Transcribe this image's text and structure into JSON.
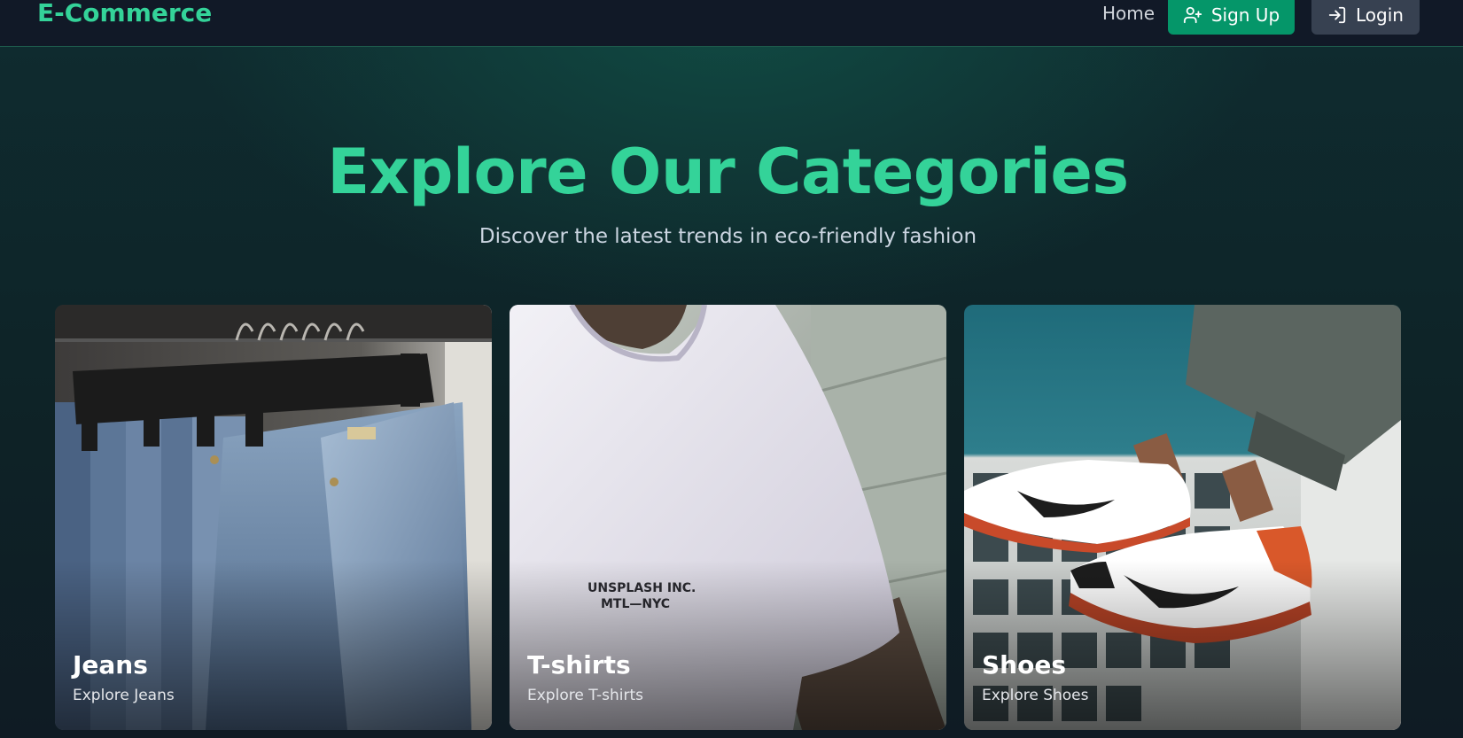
{
  "navbar": {
    "brand": "E-Commerce",
    "home_label": "Home",
    "signup_label": "Sign Up",
    "login_label": "Login"
  },
  "hero": {
    "title": "Explore Our Categories",
    "subtitle": "Discover the latest trends in eco-friendly fashion"
  },
  "categories": [
    {
      "title": "Jeans",
      "subtitle": "Explore Jeans",
      "image_text": ""
    },
    {
      "title": "T-shirts",
      "subtitle": "Explore T-shirts",
      "image_text": "UNSPLASH INC.\nMTL—NYC"
    },
    {
      "title": "Shoes",
      "subtitle": "Explore Shoes",
      "image_text": ""
    }
  ],
  "colors": {
    "accent": "#34d399",
    "signup_bg": "#059669",
    "login_bg": "#374151",
    "navbar_bg": "#111927"
  },
  "icons": {
    "signup": "user-plus-icon",
    "login": "login-arrow-icon"
  }
}
